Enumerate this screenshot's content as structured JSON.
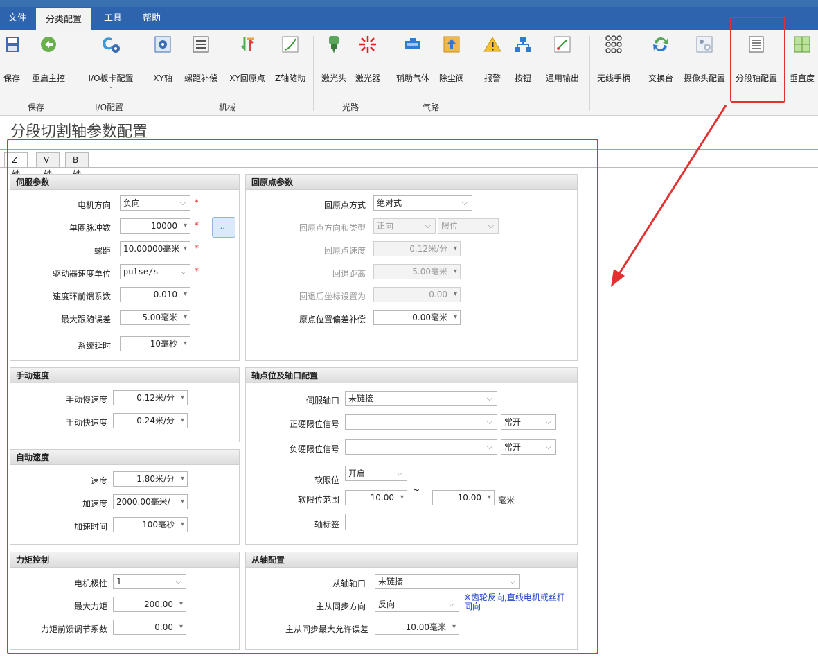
{
  "menu": [
    "文件",
    "分类配置",
    "工具",
    "帮助"
  ],
  "ribbon": {
    "buttons": [
      {
        "label": "保存",
        "icon": "save-icon"
      },
      {
        "label": "重启主控",
        "icon": "restart-icon"
      },
      {
        "label": "I/O板卡配置",
        "icon": "io-card-gear-icon"
      },
      {
        "label": "XY轴",
        "icon": "xy-axis-icon"
      },
      {
        "label": "螺距补偿",
        "icon": "pitch-compensation-icon"
      },
      {
        "label": "XY回原点",
        "icon": "xy-home-icon"
      },
      {
        "label": "Z轴随动",
        "icon": "z-follow-icon"
      },
      {
        "label": "激光头",
        "icon": "laser-head-icon"
      },
      {
        "label": "激光器",
        "icon": "laser-icon"
      },
      {
        "label": "辅助气体",
        "icon": "gas-icon"
      },
      {
        "label": "除尘阀",
        "icon": "dust-valve-icon"
      },
      {
        "label": "报警",
        "icon": "alarm-icon"
      },
      {
        "label": "按钮",
        "icon": "button-icon"
      },
      {
        "label": "通用输出",
        "icon": "general-output-icon"
      },
      {
        "label": "无线手柄",
        "icon": "wireless-handle-icon"
      },
      {
        "label": "交换台",
        "icon": "exchange-table-icon"
      },
      {
        "label": "摄像头配置",
        "icon": "camera-config-icon"
      },
      {
        "label": "分段轴配置",
        "icon": "segment-axis-icon"
      },
      {
        "label": "垂直度",
        "icon": "perpendicularity-icon"
      }
    ],
    "groups": [
      "保存",
      "I/O配置",
      "机械",
      "光路",
      "气路"
    ]
  },
  "page_title": "分段切割轴参数配置",
  "tabs": [
    "Z轴",
    "V轴",
    "B轴"
  ],
  "servo": {
    "title": "伺服参数",
    "motor_dir_label": "电机方向",
    "motor_dir": "负向",
    "pulse_label": "单圈脉冲数",
    "pulse": "10000",
    "pitch_label": "螺距",
    "pitch": "10.00000毫米",
    "speed_unit_label": "驱动器速度单位",
    "speed_unit": "pulse/s",
    "ff_label": "速度环前馈系数",
    "ff": "0.010",
    "max_err_label": "最大跟随误差",
    "max_err": "5.00毫米",
    "delay_label": "系统延时",
    "delay": "10毫秒",
    "more_button": "..."
  },
  "homing": {
    "title": "回原点参数",
    "mode_label": "回原点方式",
    "mode": "绝对式",
    "dir_label": "回原点方向和类型",
    "dir": "正向",
    "type": "限位",
    "speed_label": "回原点速度",
    "speed": "0.12米/分",
    "back_label": "回退距离",
    "back": "5.00毫米",
    "coord_label": "回退后坐标设置为",
    "coord": "0.00",
    "offset_label": "原点位置偏差补偿",
    "offset": "0.00毫米"
  },
  "manual": {
    "title": "手动速度",
    "slow_label": "手动慢速度",
    "slow": "0.12米/分",
    "fast_label": "手动快速度",
    "fast": "0.24米/分"
  },
  "auto": {
    "title": "自动速度",
    "speed_label": "速度",
    "speed": "1.80米/分",
    "acc_label": "加速度",
    "acc": "2000.00毫米/",
    "acc_time_label": "加速时间",
    "acc_time": "100毫秒"
  },
  "torque": {
    "title": "力矩控制",
    "polarity_label": "电机极性",
    "polarity": "1",
    "max_label": "最大力矩",
    "max": "200.00",
    "ff_label": "力矩前馈调节系数",
    "ff": "0.00"
  },
  "axis_port": {
    "title": "轴点位及轴口配置",
    "servo_port_label": "伺服轴口",
    "servo_port": "未链接",
    "pos_limit_label": "正硬限位信号",
    "pos_limit": "",
    "pos_limit_mode": "常开",
    "neg_limit_label": "负硬限位信号",
    "neg_limit": "",
    "neg_limit_mode": "常开",
    "soft_label": "软限位",
    "soft": "开启",
    "range_label": "软限位范围",
    "range_min": "-10.00",
    "range_sep": "~",
    "range_max": "10.00",
    "range_unit": "毫米",
    "tag_label": "轴标签",
    "tag": ""
  },
  "slave": {
    "title": "从轴配置",
    "port_label": "从轴轴口",
    "port": "未链接",
    "sync_dir_label": "主从同步方向",
    "sync_dir": "反向",
    "note": "※齿轮反向,直线电机或丝杆同向",
    "max_err_label": "主从同步最大允许误差",
    "max_err": "10.00毫米"
  },
  "colors": {
    "menubar": "#2e64ad",
    "highlight": "#e53030",
    "note": "#1f44c8",
    "divider": "#8dc63f"
  }
}
